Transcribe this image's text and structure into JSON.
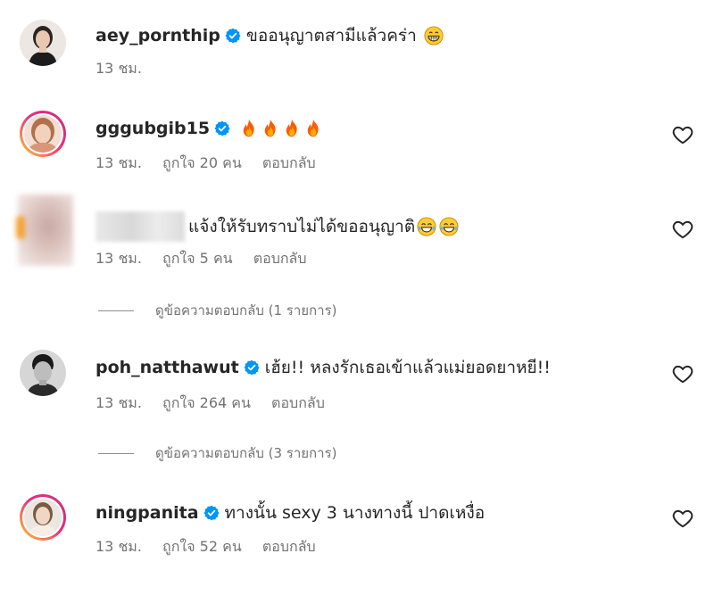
{
  "comments": [
    {
      "username": "aey_pornthip",
      "verified": true,
      "text": "ขออนุญาตสามีแล้วคร่า",
      "emoji": "grinning-face-emoji",
      "time": "13 ชม.",
      "likes": "",
      "reply": "",
      "avatar": "portrait-dark-top-woman"
    },
    {
      "username": "gggubgib15",
      "verified": true,
      "text": "",
      "emoji": "fire-emoji x4",
      "time": "13 ชม.",
      "likes": "ถูกใจ 20 คน",
      "reply": "ตอบกลับ",
      "avatar": "portrait-woman-story-ring"
    },
    {
      "username": "",
      "verified": false,
      "text": "แจ้งให้รับทราบไม่ได้ขออนุญาติ",
      "emoji": "tears-of-joy-emoji x2",
      "time": "13 ชม.",
      "likes": "ถูกใจ 5 คน",
      "reply": "ตอบกลับ",
      "avatar": "blurred-avatar",
      "view_replies": "ดูข้อความตอบกลับ (1 รายการ)"
    },
    {
      "username": "poh_natthawut",
      "verified": true,
      "text": "เฮ้ย!! หลงรักเธอเข้าแล้วแม่ยอดยาหยี!!",
      "emoji": "",
      "time": "13 ชม.",
      "likes": "ถูกใจ 264 คน",
      "reply": "ตอบกลับ",
      "avatar": "portrait-man-bw",
      "view_replies": "ดูข้อความตอบกลับ (3 รายการ)"
    },
    {
      "username": "ningpanita",
      "verified": true,
      "text": "ทางนั้น sexy 3 นางทางนี้ ปาดเหงื่อ",
      "emoji": "",
      "time": "13 ชม.",
      "likes": "ถูกใจ 52 คน",
      "reply": "ตอบกลับ",
      "avatar": "portrait-woman-story-ring"
    }
  ],
  "colors": {
    "verified": "#0095f6",
    "secondary_text": "#737373",
    "primary_text": "#262626",
    "fire": "#ff7a00"
  },
  "icons": {
    "like": "heart-outline-icon",
    "verified": "verified-badge-icon"
  }
}
